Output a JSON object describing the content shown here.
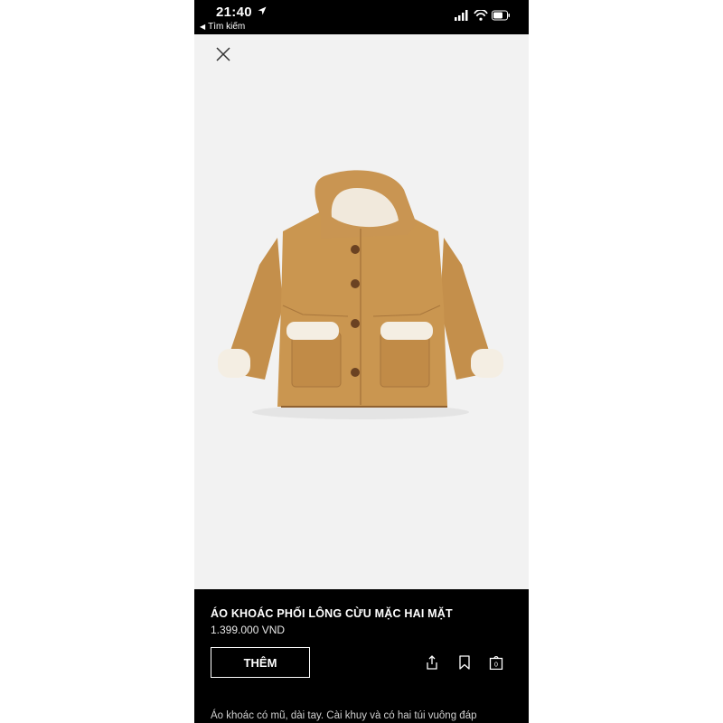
{
  "status_bar": {
    "time": "21:40",
    "back_label": "Tìm kiếm",
    "icons": [
      "location-arrow-icon",
      "signal-icon",
      "wifi-icon",
      "battery-icon"
    ]
  },
  "product": {
    "image_icon": "close-icon",
    "title": "ÁO KHOÁC PHỐI LÔNG CỪU MẶC HAI MẶT",
    "price": "1.399.000 VND",
    "add_button_label": "THÊM",
    "action_icons": [
      "share-icon",
      "bookmark-icon",
      "bag-icon"
    ],
    "bag_count": "0",
    "description": "Áo khoác có mũ, dài tay. Cài khuy và có hai túi vuông đáp"
  },
  "colors": {
    "background": "#000000",
    "image_background": "#f2f2f2",
    "coat": "#c9954f",
    "shearling": "#f3ede2",
    "text": "#ffffff"
  }
}
